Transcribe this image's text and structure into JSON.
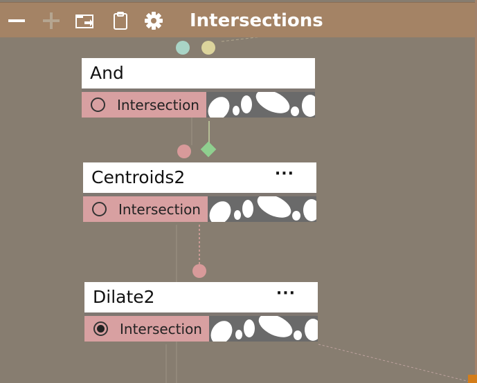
{
  "toolbar": {
    "title": "Intersections",
    "icons": [
      "minus-icon",
      "plus-icon",
      "import-icon",
      "clipboard-icon",
      "gear-icon"
    ]
  },
  "nodes": [
    {
      "title": "And",
      "menu": "",
      "row_label": "Intersection",
      "selected": false
    },
    {
      "title": "Centroids2",
      "menu": "···",
      "row_label": "Intersection",
      "selected": false
    },
    {
      "title": "Dilate2",
      "menu": "···",
      "row_label": "Intersection",
      "selected": true
    }
  ],
  "colors": {
    "background": "#877d70",
    "toolbar": "#a48365",
    "row": "#d8a0a1",
    "port_teal": "#a9d4c6",
    "port_yellow": "#dcd49c",
    "port_pink": "#d89a9a",
    "port_green": "#8fcf8f"
  }
}
